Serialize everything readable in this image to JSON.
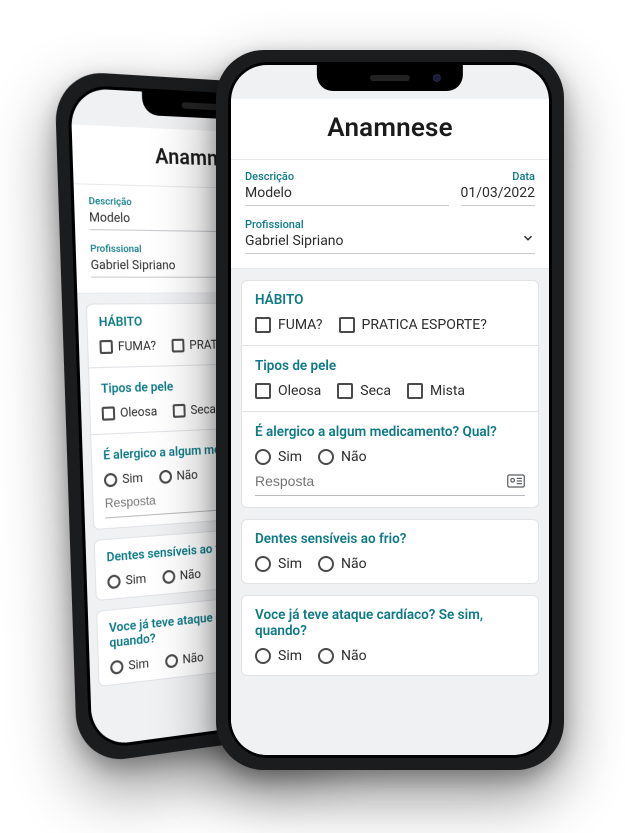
{
  "header": {
    "title": "Anamnese"
  },
  "fields": {
    "descricao_label": "Descrição",
    "descricao_value": "Modelo",
    "data_label": "Data",
    "data_value": "01/03/2022",
    "profissional_label": "Profissional",
    "profissional_value": "Gabriel Sipriano"
  },
  "groups": {
    "habito": {
      "title": "HÁBITO",
      "opt1": "FUMA?",
      "opt2": "PRATICA ESPORTE?"
    },
    "tipos_pele": {
      "title": "Tipos de pele",
      "opt1": "Oleosa",
      "opt2": "Seca",
      "opt3": "Mista"
    },
    "alergia": {
      "title": "É alergico a algum medicamento? Qual?",
      "sim": "Sim",
      "nao": "Não",
      "resposta_placeholder": "Resposta"
    },
    "dentes": {
      "title": "Dentes sensíveis ao frio?",
      "sim": "Sim",
      "nao": "Não"
    },
    "cardio": {
      "title": "Voce já teve ataque cardíaco? Se sim, quando?",
      "sim": "Sim",
      "nao": "Não"
    }
  }
}
